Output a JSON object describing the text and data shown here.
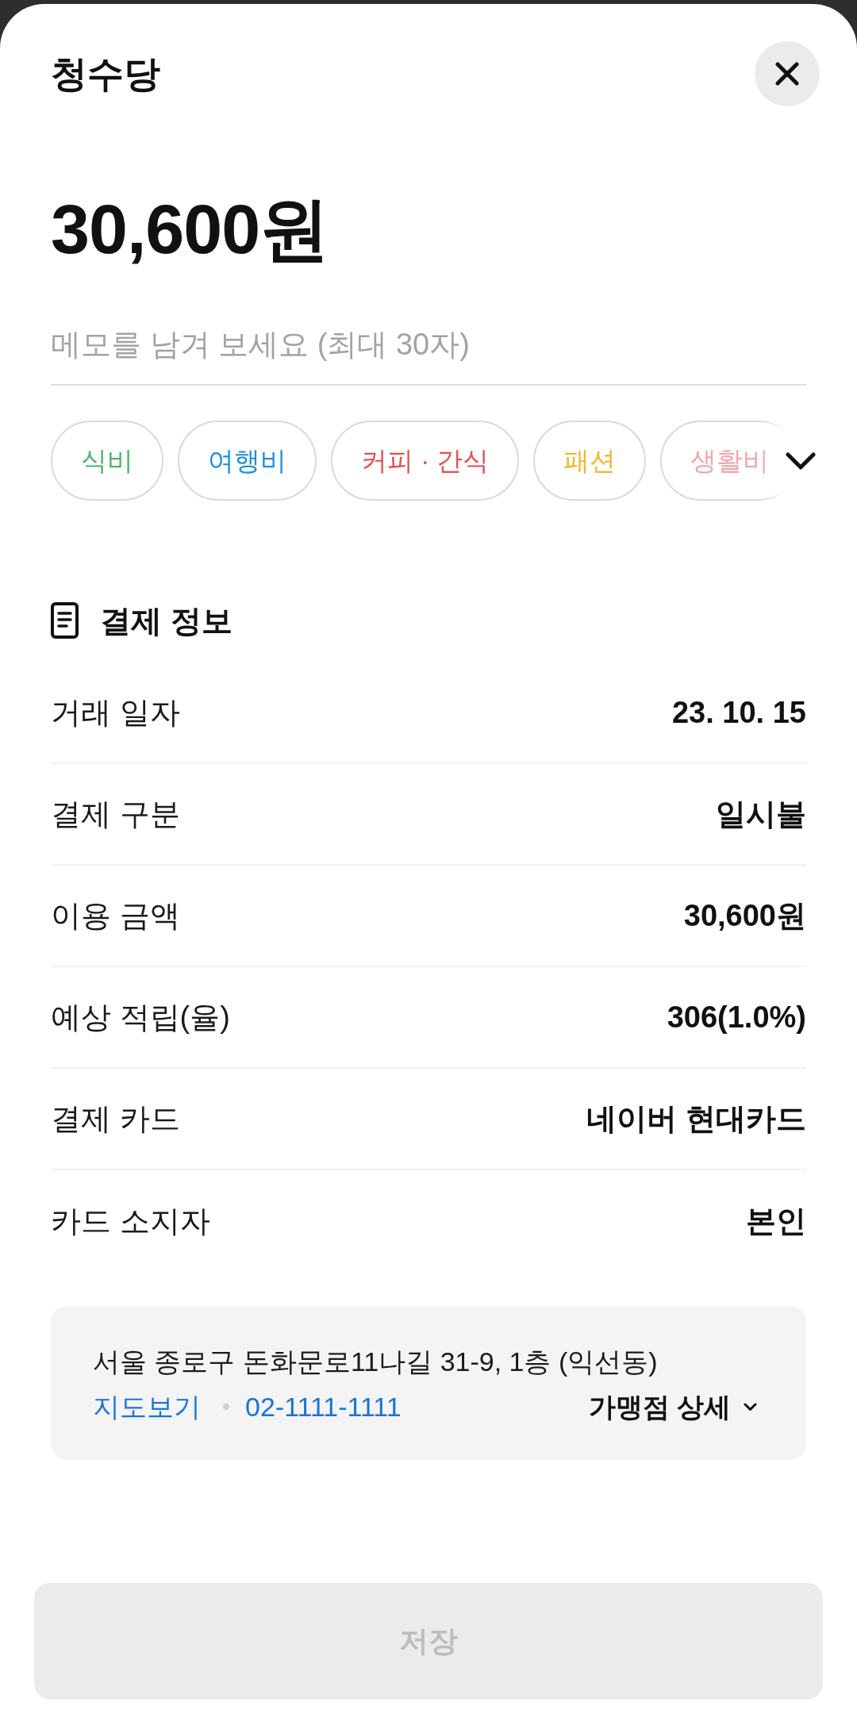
{
  "sheet": {
    "title": "청수당"
  },
  "amount": "30,600원",
  "memo": {
    "placeholder": "메모를 남겨 보세요 (최대 30자)"
  },
  "categories": [
    {
      "label": "식비",
      "color": "#45b86a",
      "selected": false
    },
    {
      "label": "여행비",
      "color": "#1c8fe0",
      "selected": false
    },
    {
      "label": "커피 · 간식",
      "color": "#e24f4f",
      "selected": false
    },
    {
      "label": "패션",
      "color": "#f0b72f",
      "selected": false
    },
    {
      "label": "생활비",
      "color": "#f2a5ab",
      "selected": false
    }
  ],
  "payment_info": {
    "title": "결제 정보",
    "rows": [
      {
        "label": "거래 일자",
        "value": "23. 10. 15"
      },
      {
        "label": "결제 구분",
        "value": "일시불"
      },
      {
        "label": "이용 금액",
        "value": "30,600원"
      },
      {
        "label": "예상 적립(율)",
        "value": "306(1.0%)"
      },
      {
        "label": "결제 카드",
        "value": "네이버 현대카드"
      },
      {
        "label": "카드 소지자",
        "value": "본인"
      }
    ]
  },
  "merchant": {
    "address": "서울 종로구 돈화문로11나길 31-9, 1층 (익선동)",
    "map_link": "지도보기",
    "phone": "02-1111-1111",
    "detail_button": "가맹점 상세"
  },
  "save_button": {
    "label": "저장",
    "disabled": true
  }
}
